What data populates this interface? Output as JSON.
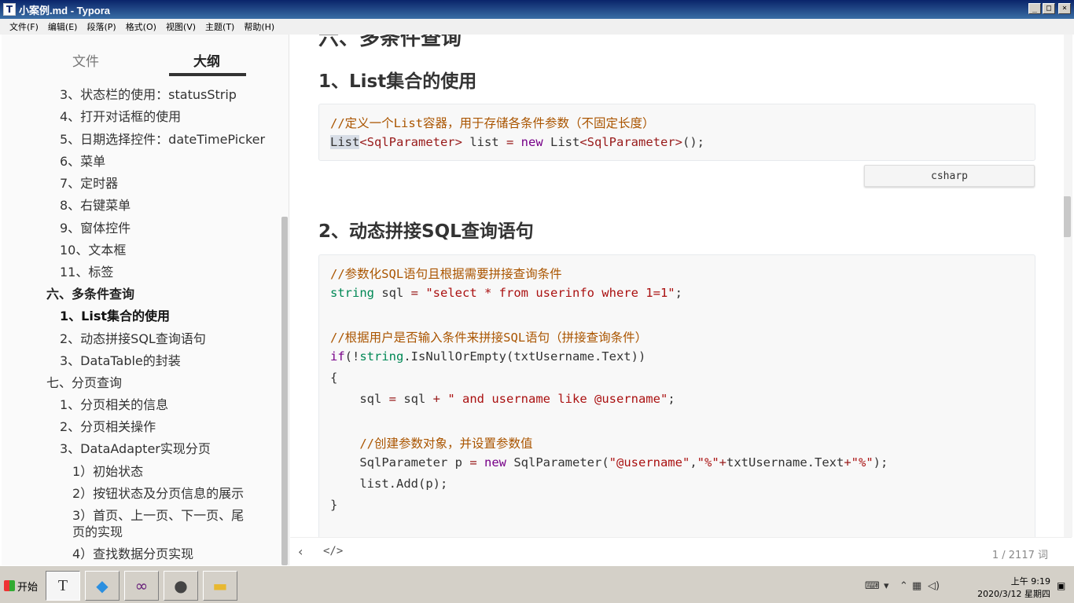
{
  "window": {
    "title": "小案例.md - Typora",
    "app_icon": "T"
  },
  "menubar": [
    "文件(F)",
    "编辑(E)",
    "段落(P)",
    "格式(O)",
    "视图(V)",
    "主题(T)",
    "帮助(H)"
  ],
  "sidebar": {
    "tabs": {
      "files": "文件",
      "outline": "大纲"
    },
    "items": [
      "3、状态栏的使用：statusStrip",
      "4、打开对话框的使用",
      "5、日期选择控件：dateTimePicker",
      "6、菜单",
      "7、定时器",
      "8、右键菜单",
      "9、窗体控件",
      "10、文本框",
      "11、标签",
      "六、多条件查询",
      "1、List集合的使用",
      "2、动态拼接SQL查询语句",
      "3、DataTable的封装",
      "七、分页查询",
      "1、分页相关的信息",
      "2、分页相关操作",
      "3、DataAdapter实现分页",
      "1）初始状态",
      "2）按钮状态及分页信息的展示",
      "3）首页、上一页、下一页、尾",
      "页的实现",
      "4）查找数据分页实现"
    ]
  },
  "editor": {
    "h1_partial": "六、多条件查询",
    "h2_1": "1、List集合的使用",
    "h2_2": "2、动态拼接SQL查询语句",
    "lang_badge": "csharp",
    "code1": {
      "comment": "//定义一个List容器，用于存储各条件参数（不固定长度）",
      "l2_a": "List",
      "l2_b": "<SqlParameter>",
      "l2_c": " list ",
      "l2_d": "=",
      "l2_e": " ",
      "l2_f": "new",
      "l2_g": " List",
      "l2_h": "<SqlParameter>",
      "l2_i": "();"
    },
    "code2": {
      "c1": "//参数化SQL语句且根据需要拼接查询条件",
      "l2_type": "string",
      "l2_var": " sql ",
      "l2_eq": "=",
      "l2_str": " \"select * from userinfo where 1=1\"",
      "l2_end": ";",
      "c2": "//根据用户是否输入条件来拼接SQL语句（拼接查询条件）",
      "l4_if": "if",
      "l4_a": "(!",
      "l4_type": "string",
      "l4_b": ".IsNullOrEmpty(txtUsername.Text))",
      "l5": "{",
      "l6_a": "    sql ",
      "l6_eq": "=",
      "l6_b": " sql ",
      "l6_plus": "+",
      "l6_str": " \" and username like @username\"",
      "l6_end": ";",
      "c3": "    //创建参数对象，并设置参数值",
      "l8_a": "    SqlParameter p ",
      "l8_eq": "=",
      "l8_sp": " ",
      "l8_new": "new",
      "l8_b": " SqlParameter(",
      "l8_s1": "\"@username\"",
      "l8_c": ",",
      "l8_s2": "\"%\"",
      "l8_p1": "+",
      "l8_d": "txtUsername.Text",
      "l8_p2": "+",
      "l8_s3": "\"%\"",
      "l8_e": ");",
      "l9": "    list.Add(p);",
      "l10": "}"
    }
  },
  "footer": {
    "back": "‹",
    "source": "</>",
    "wordcount": "1 / 2117 词"
  },
  "taskbar": {
    "start": "开始",
    "clock_time": "上午 9:19",
    "clock_date": "2020/3/12 星期四"
  }
}
